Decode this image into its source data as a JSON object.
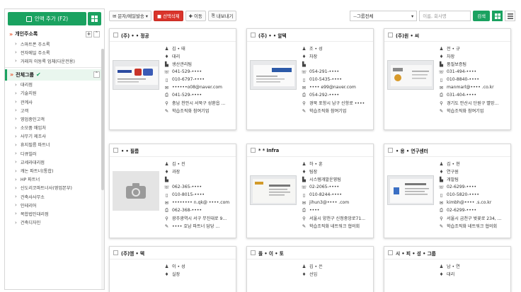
{
  "sidebar": {
    "add_button": "인맥 추가 (F2)",
    "personal_section": "개인주소록",
    "personal_items": [
      "스마트폰 주소록",
      "전자메일 주소록",
      "거래처 이동록 업체(다운전용)"
    ],
    "group_section": "전체그룹",
    "group_items": [
      "대리점",
      "기술지원",
      "관계사",
      "고객",
      "영업중인고객",
      "소모품 매입처",
      "사무기 제조사",
      "휴지필름 파트너",
      "디큐빌러",
      "교세라대리점",
      "캐논 파트너(통합)",
      "HP 파트너",
      "신도리코파트너사(영업본부)",
      "건축사사무소",
      "인테리어",
      "복합법인대리점",
      "건축디자인"
    ]
  },
  "toolbar": {
    "mail_button": "문자/메일발송",
    "delete_button": "선택삭제",
    "move_button": "이동",
    "export_button": "내보내기",
    "group_select": "--그룹전체",
    "search_placeholder": "이름, 회사명",
    "search_button": "검색"
  },
  "cards": [
    {
      "company": "(주) • • 정공",
      "name": "김 • 태",
      "position": "대리",
      "dept": "생산관리팀",
      "phone": "041-529-••••",
      "mobile": "010-6797-••••",
      "email": "••••••o08@naver.com",
      "fax": "041-529-••••",
      "address": "충남 천안시 서북구 성환읍 ...",
      "note": "학습조직화 참여기업",
      "card_type": "card1"
    },
    {
      "company": "(주) • • 알텍",
      "name": "조 • 성",
      "position": "차장",
      "dept": "",
      "phone": "054-291-••••",
      "mobile": "010-5435-••••",
      "email": "•••• e99@naver.com",
      "fax": "054-292-••••",
      "address": "경북 포항시 남구 신항로 ••••",
      "note": "학습조직화 참여기업",
      "card_type": "card2"
    },
    {
      "company": "(주)원 • 씨",
      "name": "전 • 규",
      "position": "차장",
      "dept": "품질보증팀",
      "phone": "031-494-••••",
      "mobile": "010-8840-••••",
      "email": "manmarl@•••• .co.kr",
      "fax": "031-404-••••",
      "address": "경기도 안산시 단원구 별망...",
      "note": "학습조직화 참여기업",
      "card_type": "card3"
    },
    {
      "company": "• • 필름",
      "name": "김 • 진",
      "position": "과장",
      "dept": "",
      "phone": "062-365-••••",
      "mobile": "010-8015-••••",
      "email": "•••••••• n.qk@ ••••.com",
      "fax": "062-368-••••",
      "address": "광주광역시 서구 무진대로 9...",
      "note": "•••• 호남 파트너 담당 ...",
      "card_type": "placeholder"
    },
    {
      "company": "* * Infra",
      "name": "하 • 훈",
      "position": "팀장",
      "dept": "시스템개발운영팀",
      "phone": "02-2065-••••",
      "mobile": "010-8244-••••",
      "email": "jihun3@•••• .com",
      "fax": "••••",
      "address": "서울시 양천구 신정중앙로71...",
      "note": "학습조직화 네트워크 협의회",
      "card_type": "card4"
    },
    {
      "company": "• 용 • 연구센터",
      "name": "김 • 현",
      "position": "연구원",
      "dept": "개발팀",
      "phone": "02-6299-••••",
      "mobile": "010-5820-••••",
      "email": "kimbh@•••• .s.co.kr",
      "fax": "02-6299-••••",
      "address": "서울시 금천구 벚꽃로 234, ...",
      "note": "학습조직화 네트워크 협의회",
      "card_type": "card5"
    },
    {
      "company": "(주)엠 • 텍",
      "name": "이 • 성",
      "position": "실장",
      "dept": "",
      "phone": "",
      "mobile": "",
      "email": "",
      "fax": "",
      "address": "",
      "note": "",
      "card_type": "none"
    },
    {
      "company": "플 • 이 • 토",
      "name": "김 • 은",
      "position": "선임",
      "dept": "",
      "phone": "",
      "mobile": "",
      "email": "",
      "fax": "",
      "address": "",
      "note": "",
      "card_type": "none"
    },
    {
      "company": "시 • 피 • 성 • 그룹",
      "name": "남 • 연",
      "position": "대리",
      "dept": "",
      "phone": "",
      "mobile": "",
      "email": "",
      "fax": "",
      "address": "",
      "note": "",
      "card_type": "none"
    }
  ],
  "colors": {
    "accent": "#1aa260",
    "danger": "#d9342b",
    "orange": "#e8552c"
  }
}
